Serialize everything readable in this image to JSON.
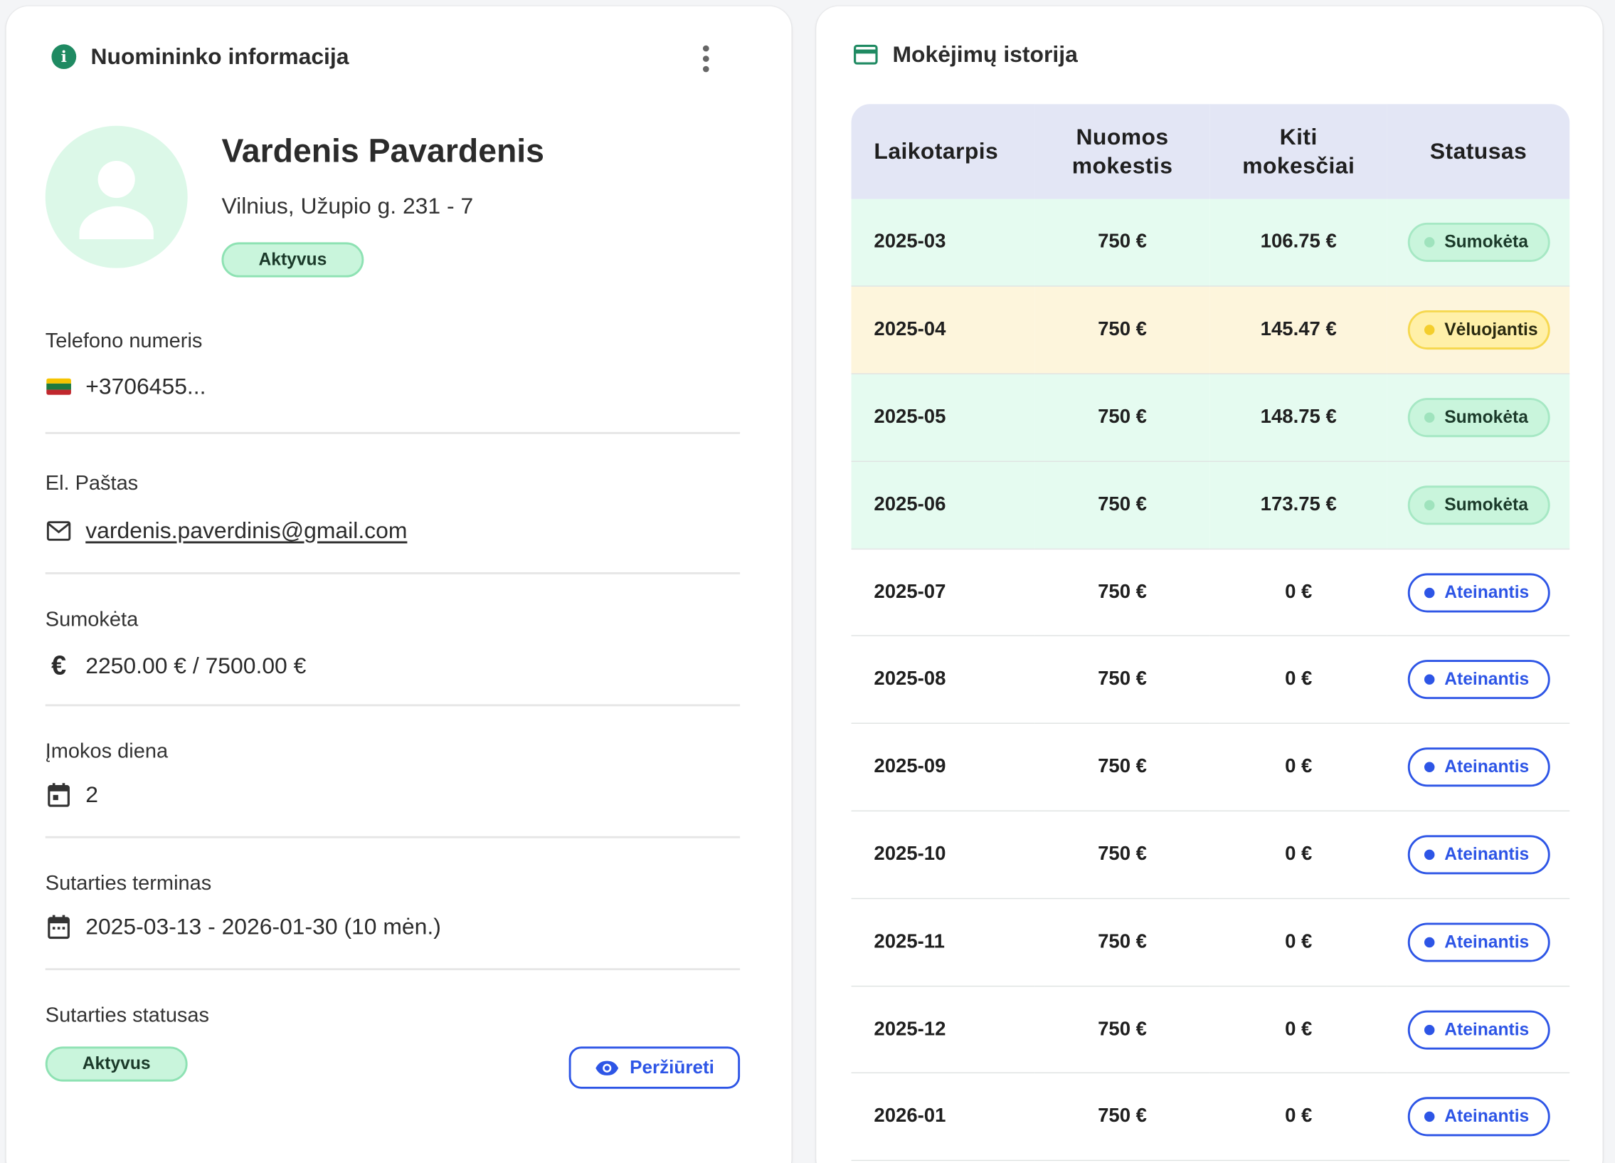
{
  "tenant_card": {
    "title": "Nuomininko informacija",
    "name": "Vardenis Pavardenis",
    "address": "Vilnius, Užupio g. 231 - 7",
    "status": "Aktyvus",
    "phone_label": "Telefono numeris",
    "phone_value": "+3706455...",
    "email_label": "El. Paštas",
    "email_value": "vardenis.paverdinis@gmail.com",
    "paid_label": "Sumokėta",
    "paid_value": "2250.00 € / 7500.00 €",
    "payday_label": "Įmokos diena",
    "payday_value": "2",
    "term_label": "Sutarties terminas",
    "term_value": "2025-03-13 - 2026-01-30 (10 mėn.)",
    "contract_status_label": "Sutarties statusas",
    "contract_status": "Aktyvus",
    "view_button": "Peržiūreti",
    "flag_colors": [
      "#f5c400",
      "#1d7a3f",
      "#c1272d"
    ]
  },
  "payments_card": {
    "title": "Mokėjimų istorija",
    "columns": [
      "Laikotarpis",
      "Nuomos mokestis",
      "Kiti mokesčiai",
      "Statusas"
    ],
    "rows": [
      {
        "period": "2025-03",
        "rent": "750 €",
        "other": "106.75 €",
        "status": "Sumokėta",
        "kind": "paid"
      },
      {
        "period": "2025-04",
        "rent": "750 €",
        "other": "145.47 €",
        "status": "Vėluojantis",
        "kind": "late"
      },
      {
        "period": "2025-05",
        "rent": "750 €",
        "other": "148.75 €",
        "status": "Sumokėta",
        "kind": "paid"
      },
      {
        "period": "2025-06",
        "rent": "750 €",
        "other": "173.75 €",
        "status": "Sumokėta",
        "kind": "paid"
      },
      {
        "period": "2025-07",
        "rent": "750 €",
        "other": "0 €",
        "status": "Ateinantis",
        "kind": "upcoming"
      },
      {
        "period": "2025-08",
        "rent": "750 €",
        "other": "0 €",
        "status": "Ateinantis",
        "kind": "upcoming"
      },
      {
        "period": "2025-09",
        "rent": "750 €",
        "other": "0 €",
        "status": "Ateinantis",
        "kind": "upcoming"
      },
      {
        "period": "2025-10",
        "rent": "750 €",
        "other": "0 €",
        "status": "Ateinantis",
        "kind": "upcoming"
      },
      {
        "period": "2025-11",
        "rent": "750 €",
        "other": "0 €",
        "status": "Ateinantis",
        "kind": "upcoming"
      },
      {
        "period": "2025-12",
        "rent": "750 €",
        "other": "0 €",
        "status": "Ateinantis",
        "kind": "upcoming"
      },
      {
        "period": "2026-01",
        "rent": "750 €",
        "other": "0 €",
        "status": "Ateinantis",
        "kind": "upcoming"
      }
    ]
  },
  "icons": {
    "info": "info-icon",
    "menu": "kebab-menu-icon",
    "avatar": "person-icon",
    "email": "mail-icon",
    "euro": "euro-icon",
    "calendar": "calendar-icon",
    "eye": "eye-icon",
    "card": "credit-card-icon"
  },
  "colors": {
    "accent_green": "#1f8a62",
    "active_bg": "#c9f5dc",
    "paid_row": "#e5fbf0",
    "late_row": "#fdf5dc",
    "upcoming_blue": "#2d55e6",
    "table_header": "#e3e6f5"
  }
}
